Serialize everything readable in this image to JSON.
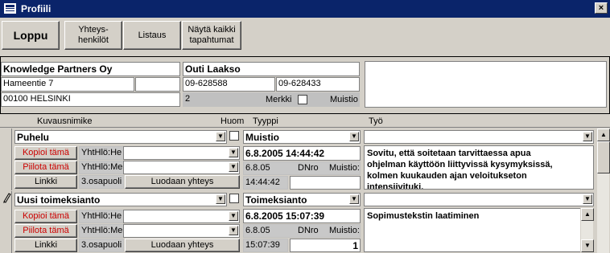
{
  "window": {
    "title": "Profiili",
    "close_glyph": "×"
  },
  "toolbar": {
    "loppu": "Loppu",
    "yhteyshenkilot": "Yhteys-\nhenkilöt",
    "listaus": "Listaus",
    "nayta_kaikki": "Näytä kaikki\ntapahtumat"
  },
  "header": {
    "company": "Knowledge Partners Oy",
    "street": "Hameentie 7",
    "street_extra": "",
    "postal": "00100 HELSINKI",
    "person": "Outi Laakso",
    "phone1": "09-628588",
    "phone2": "09-628433",
    "count": "2",
    "merkki_label": "Merkki",
    "muistio_label": "Muistio",
    "notes": ""
  },
  "columns": {
    "kuvausnimike": "Kuvausnimike",
    "huom": "Huom",
    "tyyppi": "Tyyppi",
    "tyo": "Työ"
  },
  "records": [
    {
      "kuvaus": "Puhelu",
      "tyyppi": "Muistio",
      "tyo": "",
      "kopioi": "Kopioi tämä",
      "piilota": "Piilota tämä",
      "linkki": "Linkki",
      "yht1_label": "YhtHlö:He",
      "yht2_label": "YhtHlö:Me",
      "osapuoli_label": "3.osapuoli",
      "luodaan": "Luodaan yhteys",
      "datetime": "6.8.2005 14:44:42",
      "date": "6.8.05",
      "dnro_label": "DNro",
      "muistio_label": "Muistio:",
      "time": "14:44:42",
      "muistio_value": "",
      "memo": "Sovitu, että soitetaan tarvittaessa apua\nohjelman käyttöön liittyvissä kysymyksissä,\nkolmen kuukauden ajan veloitukseton\nintensiivituki."
    },
    {
      "kuvaus": "Uusi toimeksianto",
      "tyyppi": "Toimeksianto",
      "tyo": "",
      "kopioi": "Kopioi tämä",
      "piilota": "Piilota tämä",
      "linkki": "Linkki",
      "yht1_label": "YhtHlö:He",
      "yht2_label": "YhtHlö:Me",
      "osapuoli_label": "3.osapuoli",
      "luodaan": "Luodaan yhteys",
      "datetime": "6.8.2005 15:07:39",
      "date": "6.8.05",
      "dnro_label": "DNro",
      "muistio_label": "Muistio:",
      "time": "15:07:39",
      "muistio_value": "1",
      "memo": "Sopimustekstin laatiminen"
    }
  ],
  "icons": {
    "dropdown": "dropdown-arrow-icon",
    "edit": "pencil-icon",
    "scroll_up": "scroll-up-icon",
    "scroll_down": "scroll-down-icon"
  }
}
